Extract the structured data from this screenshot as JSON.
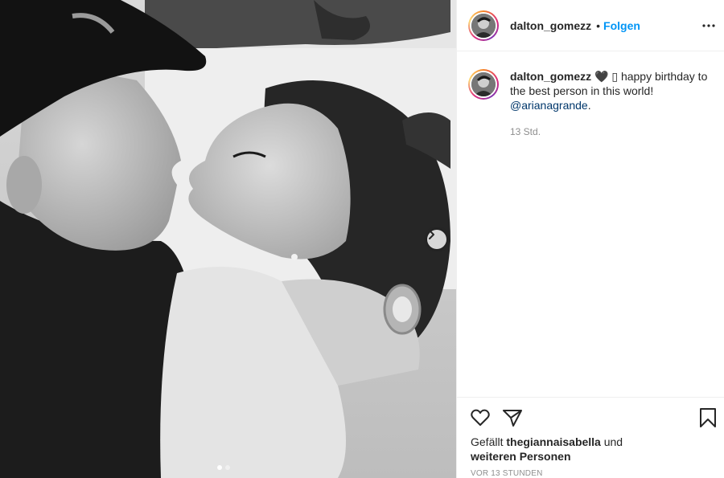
{
  "post": {
    "username": "dalton_gomezz",
    "separator": "•",
    "follow_label": "Folgen",
    "caption": {
      "username": "dalton_gomezz",
      "emoji": "🖤",
      "emoji2": "▯",
      "text": "happy birthday to the best person in this world!",
      "mention": "@arianagrande",
      "mention_suffix": ".",
      "age": "13 Std."
    },
    "likes": {
      "prefix": "Gefällt",
      "liker": "thegiannaisabella",
      "conjunction": "und",
      "others": "weiteren Personen"
    },
    "timestamp": "VOR 13 STUNDEN",
    "carousel": {
      "slides": 2,
      "active": 1
    }
  },
  "icons": {
    "more": "more-horizontal-icon",
    "like": "heart-icon",
    "share": "paper-plane-icon",
    "save": "bookmark-icon",
    "next": "chevron-right-icon"
  },
  "colors": {
    "accent": "#0095f6",
    "text": "#262626",
    "muted": "#8e8e8e",
    "mention": "#00376b",
    "border": "#efefef"
  }
}
